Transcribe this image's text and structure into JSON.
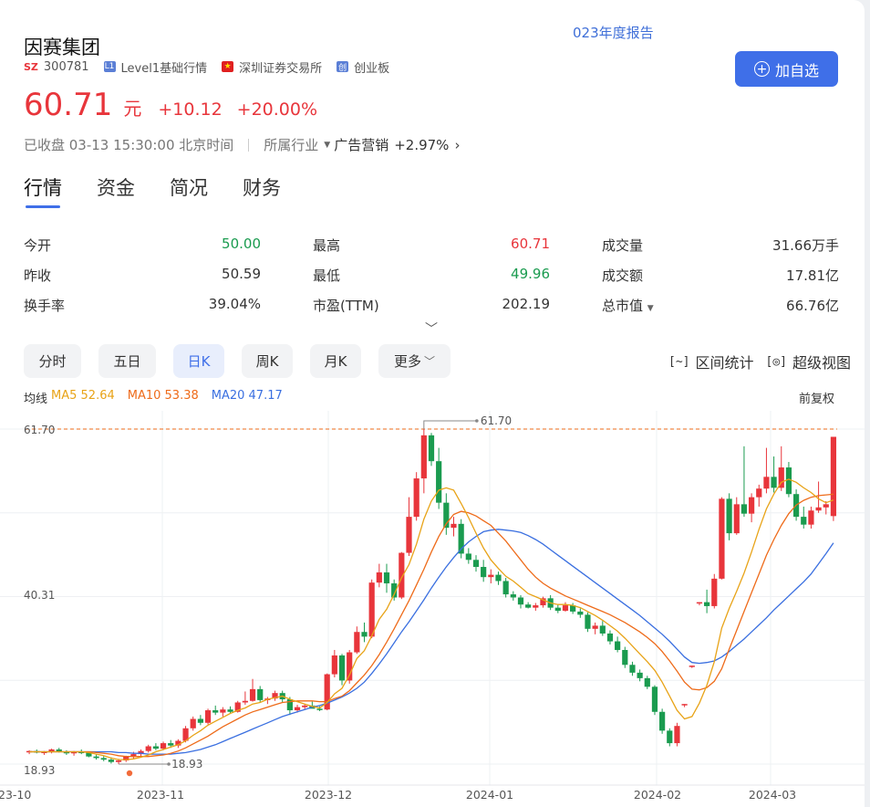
{
  "announcement": "023年度报告",
  "stock": {
    "name": "因赛集团",
    "market_badge": "SZ",
    "code": "300781",
    "level_badge": "L1",
    "level": "Level1基础行情",
    "exchange_icon": "cn-flag-icon",
    "exchange": "深圳证券交易所",
    "board_badge": "创",
    "board": "创业板",
    "add_button": "加自选"
  },
  "price": {
    "last": "60.71",
    "unit": "元",
    "change": "+10.12",
    "change_pct": "+20.00%"
  },
  "status": {
    "text": "已收盘 03-13 15:30:00 北京时间",
    "industry_label": "所属行业",
    "industry": "广告营销",
    "industry_change": "+2.97%"
  },
  "tabs": [
    "行情",
    "资金",
    "简况",
    "财务"
  ],
  "quotes": [
    [
      {
        "label": "今开",
        "value": "50.00",
        "tone": "g"
      },
      {
        "label": "最高",
        "value": "60.71",
        "tone": "r"
      },
      {
        "label": "成交量",
        "value": "31.66万手",
        "tone": "n"
      }
    ],
    [
      {
        "label": "昨收",
        "value": "50.59",
        "tone": "n"
      },
      {
        "label": "最低",
        "value": "49.96",
        "tone": "g"
      },
      {
        "label": "成交额",
        "value": "17.81亿",
        "tone": "n"
      }
    ],
    [
      {
        "label": "换手率",
        "value": "39.04%",
        "tone": "n"
      },
      {
        "label": "市盈(TTM)",
        "value": "202.19",
        "tone": "n"
      },
      {
        "label": "总市值",
        "value": "66.76亿",
        "tone": "n"
      }
    ]
  ],
  "periods": [
    "分时",
    "五日",
    "日K",
    "周K",
    "月K",
    "更多"
  ],
  "active_period": "日K",
  "tools": [
    "区间统计",
    "超级视图"
  ],
  "legend": {
    "label": "均线",
    "ma5": "MA5 52.64",
    "ma10": "MA10 53.38",
    "ma20": "MA20 47.17",
    "adjust": "前复权"
  },
  "colors": {
    "up": "#e8353b",
    "down": "#1a9b4f",
    "ma5": "#e8a317",
    "ma10": "#ee6b1a",
    "ma20": "#3a6fe0",
    "accent": "#3f6fe8"
  },
  "chart_data": {
    "type": "candlestick",
    "y_labels": [
      "61.70",
      "40.31",
      "18.93"
    ],
    "x_labels": [
      "23-10",
      "2023-11",
      "2023-12",
      "2024-01",
      "2024-02",
      "2024-03"
    ],
    "ylim": [
      18.93,
      61.7
    ],
    "max_marker": "61.70",
    "min_marker": "18.93",
    "candles": [
      [
        20.5,
        20.7,
        20.2,
        20.6
      ],
      [
        20.6,
        20.8,
        20.3,
        20.4
      ],
      [
        20.4,
        20.6,
        20.1,
        20.5
      ],
      [
        20.5,
        20.9,
        20.3,
        20.8
      ],
      [
        20.8,
        21.0,
        20.4,
        20.5
      ],
      [
        20.5,
        20.7,
        20.1,
        20.3
      ],
      [
        20.3,
        20.6,
        20.0,
        20.5
      ],
      [
        20.5,
        20.8,
        20.2,
        20.4
      ],
      [
        20.4,
        20.5,
        19.8,
        19.9
      ],
      [
        19.9,
        20.2,
        19.5,
        19.7
      ],
      [
        19.7,
        20.0,
        19.3,
        19.5
      ],
      [
        19.5,
        19.8,
        19.0,
        19.2
      ],
      [
        19.2,
        19.6,
        18.93,
        19.4
      ],
      [
        19.4,
        20.0,
        19.2,
        19.9
      ],
      [
        19.9,
        20.5,
        19.6,
        20.2
      ],
      [
        20.2,
        20.8,
        19.9,
        20.6
      ],
      [
        20.6,
        21.4,
        20.4,
        21.2
      ],
      [
        21.2,
        21.6,
        20.7,
        20.9
      ],
      [
        20.9,
        21.8,
        20.7,
        21.6
      ],
      [
        21.6,
        22.0,
        21.0,
        21.3
      ],
      [
        21.3,
        22.1,
        21.0,
        21.9
      ],
      [
        21.9,
        23.8,
        21.7,
        23.5
      ],
      [
        23.5,
        25.0,
        23.2,
        24.7
      ],
      [
        24.7,
        25.2,
        23.9,
        24.2
      ],
      [
        24.2,
        26.0,
        24.0,
        25.8
      ],
      [
        25.8,
        26.4,
        25.2,
        25.5
      ],
      [
        25.5,
        26.2,
        25.0,
        25.9
      ],
      [
        25.9,
        26.3,
        25.4,
        25.6
      ],
      [
        25.6,
        27.0,
        25.5,
        26.8
      ],
      [
        26.8,
        28.2,
        26.5,
        27.0
      ],
      [
        27.0,
        29.8,
        26.9,
        28.5
      ],
      [
        28.5,
        28.9,
        26.8,
        27.1
      ],
      [
        27.1,
        27.5,
        26.6,
        27.3
      ],
      [
        27.3,
        28.3,
        27.0,
        28.0
      ],
      [
        28.0,
        28.3,
        26.8,
        27.2
      ],
      [
        27.2,
        27.5,
        25.2,
        25.8
      ],
      [
        25.8,
        26.5,
        25.5,
        26.2
      ],
      [
        26.2,
        26.6,
        25.9,
        26.4
      ],
      [
        26.4,
        26.9,
        26.1,
        26.0
      ],
      [
        26.0,
        26.3,
        25.7,
        25.9
      ],
      [
        25.9,
        30.5,
        25.8,
        30.4
      ],
      [
        30.4,
        33.5,
        30.0,
        32.8
      ],
      [
        32.8,
        33.0,
        29.0,
        29.6
      ],
      [
        29.6,
        33.5,
        29.2,
        33.2
      ],
      [
        33.2,
        36.5,
        33.0,
        35.8
      ],
      [
        35.8,
        37.0,
        34.5,
        35.2
      ],
      [
        35.2,
        42.5,
        35.0,
        42.1
      ],
      [
        42.1,
        44.5,
        41.5,
        43.4
      ],
      [
        43.4,
        44.5,
        40.8,
        42.0
      ],
      [
        42.0,
        42.5,
        39.8,
        40.2
      ],
      [
        40.2,
        46.0,
        40.0,
        45.9
      ],
      [
        45.9,
        53.0,
        45.5,
        50.5
      ],
      [
        50.5,
        56.2,
        50.0,
        55.4
      ],
      [
        55.4,
        61.7,
        53.5,
        60.9
      ],
      [
        60.9,
        61.2,
        57.0,
        57.6
      ],
      [
        57.6,
        59.3,
        51.5,
        52.3
      ],
      [
        52.3,
        53.5,
        48.2,
        49.1
      ],
      [
        49.1,
        50.5,
        48.0,
        49.6
      ],
      [
        49.6,
        50.2,
        45.2,
        45.8
      ],
      [
        45.8,
        46.5,
        44.5,
        45.0
      ],
      [
        45.0,
        45.6,
        43.5,
        44.1
      ],
      [
        44.1,
        45.0,
        42.2,
        42.8
      ],
      [
        42.8,
        43.8,
        42.0,
        43.1
      ],
      [
        43.1,
        43.5,
        41.8,
        42.3
      ],
      [
        42.3,
        42.7,
        40.2,
        40.6
      ],
      [
        40.6,
        41.0,
        39.8,
        40.2
      ],
      [
        40.2,
        40.5,
        38.8,
        39.3
      ],
      [
        39.3,
        39.6,
        38.8,
        38.9
      ],
      [
        38.9,
        39.5,
        38.5,
        39.2
      ],
      [
        39.2,
        40.3,
        38.9,
        40.1
      ],
      [
        40.1,
        40.5,
        38.6,
        38.9
      ],
      [
        38.9,
        39.3,
        38.2,
        38.5
      ],
      [
        38.5,
        39.6,
        38.4,
        39.2
      ],
      [
        39.2,
        39.5,
        38.1,
        38.4
      ],
      [
        38.4,
        38.8,
        37.6,
        38.0
      ],
      [
        38.0,
        38.3,
        35.8,
        36.2
      ],
      [
        36.2,
        37.0,
        35.5,
        36.6
      ],
      [
        36.6,
        37.2,
        35.3,
        35.6
      ],
      [
        35.6,
        36.0,
        34.2,
        34.6
      ],
      [
        34.6,
        35.2,
        33.2,
        33.5
      ],
      [
        33.5,
        33.9,
        31.2,
        31.6
      ],
      [
        31.6,
        32.0,
        30.2,
        30.6
      ],
      [
        30.6,
        31.0,
        29.5,
        29.9
      ],
      [
        29.9,
        30.2,
        28.5,
        28.8
      ],
      [
        28.8,
        29.0,
        25.2,
        25.6
      ],
      [
        25.6,
        26.0,
        22.8,
        23.2
      ],
      [
        23.2,
        23.5,
        21.2,
        21.6
      ],
      [
        21.6,
        24.2,
        21.2,
        23.8
      ],
      [
        26.6,
        26.6,
        26.2,
        26.6
      ],
      [
        31.5,
        31.5,
        31.2,
        31.5
      ],
      [
        39.6,
        39.6,
        39.2,
        39.6
      ],
      [
        39.6,
        41.2,
        38.2,
        39.1
      ],
      [
        39.1,
        43.2,
        38.8,
        42.6
      ],
      [
        42.6,
        53.0,
        42.5,
        52.8
      ],
      [
        52.8,
        53.5,
        47.5,
        48.4
      ],
      [
        48.4,
        53.0,
        48.2,
        52.1
      ],
      [
        52.1,
        59.5,
        50.5,
        50.9
      ],
      [
        50.9,
        53.5,
        49.8,
        53.0
      ],
      [
        53.0,
        54.6,
        51.8,
        54.1
      ],
      [
        54.1,
        59.3,
        53.5,
        55.6
      ],
      [
        55.6,
        58.2,
        53.6,
        54.2
      ],
      [
        54.2,
        59.5,
        53.8,
        56.8
      ],
      [
        56.8,
        57.5,
        53.0,
        53.4
      ],
      [
        53.4,
        54.0,
        50.0,
        50.5
      ],
      [
        50.5,
        51.8,
        49.0,
        49.5
      ],
      [
        49.5,
        51.8,
        49.0,
        51.3
      ],
      [
        51.3,
        55.0,
        51.0,
        51.7
      ],
      [
        51.7,
        52.5,
        50.8,
        52.1
      ],
      [
        50.59,
        60.71,
        49.96,
        60.71
      ]
    ],
    "ma5": [
      20.5,
      20.5,
      20.5,
      20.5,
      20.5,
      20.5,
      20.5,
      20.5,
      20.4,
      20.2,
      20.0,
      19.7,
      19.5,
      19.5,
      19.6,
      19.8,
      20.1,
      20.5,
      20.8,
      21.1,
      21.4,
      21.9,
      22.6,
      23.2,
      23.9,
      24.4,
      24.9,
      25.4,
      25.8,
      26.1,
      26.6,
      26.8,
      27.2,
      27.4,
      27.6,
      27.2,
      26.9,
      26.6,
      26.3,
      26.1,
      26.8,
      27.9,
      28.6,
      30.3,
      32.4,
      33.4,
      35.3,
      37.4,
      38.7,
      40.6,
      42.7,
      44.4,
      47.0,
      50.2,
      52.5,
      53.9,
      54.2,
      53.9,
      52.2,
      50.4,
      48.4,
      46.5,
      45.0,
      43.9,
      42.9,
      42.3,
      41.5,
      40.7,
      40.3,
      39.9,
      39.5,
      39.3,
      39.3,
      39.2,
      38.9,
      38.4,
      37.9,
      37.3,
      36.6,
      35.9,
      35.0,
      34.0,
      33.0,
      32.0,
      30.9,
      29.4,
      27.6,
      25.8,
      24.7,
      25.0,
      26.7,
      29.0,
      32.0,
      36.3,
      38.8,
      41.0,
      43.3,
      46.0,
      48.9,
      51.5,
      53.4,
      54.9,
      55.3,
      54.9,
      54.2,
      53.6,
      52.8,
      52.3,
      52.64
    ],
    "ma10": [
      20.5,
      20.5,
      20.5,
      20.5,
      20.5,
      20.5,
      20.5,
      20.5,
      20.5,
      20.4,
      20.3,
      20.2,
      20.0,
      19.9,
      19.9,
      19.9,
      19.9,
      20.0,
      20.1,
      20.3,
      20.6,
      21.0,
      21.5,
      22.0,
      22.5,
      23.1,
      23.7,
      24.2,
      24.7,
      25.2,
      25.6,
      25.9,
      26.2,
      26.5,
      26.8,
      26.9,
      27.0,
      27.0,
      27.0,
      26.9,
      26.9,
      27.3,
      27.6,
      28.3,
      29.3,
      30.3,
      31.5,
      32.9,
      34.5,
      36.2,
      38.0,
      39.8,
      41.8,
      43.8,
      46.0,
      48.0,
      49.6,
      50.8,
      51.2,
      51.0,
      50.6,
      50.0,
      49.4,
      48.4,
      47.4,
      46.2,
      45.0,
      43.8,
      42.8,
      42.0,
      41.4,
      40.9,
      40.4,
      40.0,
      39.6,
      39.2,
      38.8,
      38.4,
      38.0,
      37.5,
      37.0,
      36.4,
      35.8,
      35.1,
      34.3,
      33.3,
      32.1,
      30.8,
      29.4,
      28.5,
      28.4,
      28.7,
      29.5,
      31.1,
      33.6,
      36.0,
      38.4,
      40.8,
      43.2,
      45.6,
      47.6,
      49.4,
      50.9,
      52.0,
      52.6,
      53.0,
      53.2,
      53.3,
      53.38
    ],
    "ma20": [
      20.5,
      20.5,
      20.5,
      20.5,
      20.5,
      20.5,
      20.5,
      20.5,
      20.5,
      20.5,
      20.5,
      20.5,
      20.4,
      20.4,
      20.3,
      20.3,
      20.2,
      20.2,
      20.2,
      20.2,
      20.3,
      20.4,
      20.6,
      20.8,
      21.1,
      21.4,
      21.8,
      22.2,
      22.6,
      23.0,
      23.4,
      23.8,
      24.2,
      24.6,
      25.0,
      25.3,
      25.6,
      25.9,
      26.2,
      26.4,
      26.7,
      27.1,
      27.5,
      28.0,
      28.6,
      29.4,
      30.5,
      31.7,
      33.0,
      34.4,
      35.8,
      37.1,
      38.5,
      39.9,
      41.4,
      42.8,
      44.1,
      45.3,
      46.4,
      47.3,
      48.0,
      48.6,
      48.8,
      48.9,
      48.8,
      48.7,
      48.5,
      48.1,
      47.6,
      47.0,
      46.3,
      45.6,
      44.9,
      44.2,
      43.5,
      42.8,
      42.1,
      41.4,
      40.7,
      40.0,
      39.3,
      38.6,
      37.9,
      37.1,
      36.3,
      35.5,
      34.6,
      33.6,
      32.6,
      31.9,
      31.8,
      31.9,
      32.1,
      32.6,
      33.3,
      34.1,
      34.9,
      35.8,
      36.7,
      37.6,
      38.6,
      39.5,
      40.4,
      41.3,
      42.2,
      43.2,
      44.5,
      45.8,
      47.17
    ]
  }
}
